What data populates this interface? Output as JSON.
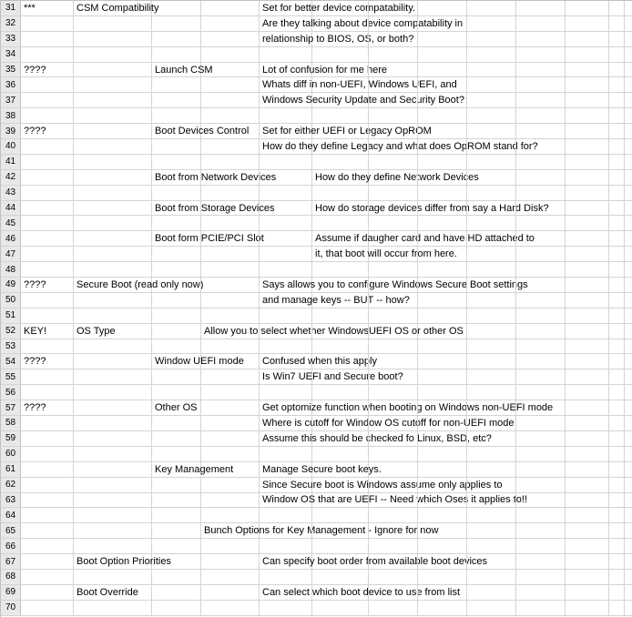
{
  "rows": [
    {
      "num": "31",
      "a": "***",
      "b": "CSM Compatibility",
      "e": "Set for better device compatability."
    },
    {
      "num": "32",
      "e": "Are they talking about device compatability in"
    },
    {
      "num": "33",
      "e": "relationship to BIOS, OS, or both?"
    },
    {
      "num": "34"
    },
    {
      "num": "35",
      "a": "????",
      "c": "Launch CSM",
      "e": "Lot of confusion for me here"
    },
    {
      "num": "36",
      "e": "Whats diff in non-UEFI, Windows UEFI, and"
    },
    {
      "num": "37",
      "e": "Windows Security Update and Security Boot?"
    },
    {
      "num": "38"
    },
    {
      "num": "39",
      "a": "????",
      "c": "Boot Devices Control",
      "e": " Set for either UEFI or Legacy OpROM"
    },
    {
      "num": "40",
      "e": "How do they define Legacy and what does OpROM stand for?"
    },
    {
      "num": "41"
    },
    {
      "num": "42",
      "c": "Boot from Network Devices",
      "f": "How do they define Network Devices"
    },
    {
      "num": "43"
    },
    {
      "num": "44",
      "c": "Boot from Storage Devices",
      "f": "How do storage devices differ from say a Hard Disk?"
    },
    {
      "num": "45"
    },
    {
      "num": "46",
      "c": "Boot form PCIE/PCI Slot",
      "f": "Assume if daugher card and have HD attached to"
    },
    {
      "num": "47",
      "f": "it, that boot will occur from here."
    },
    {
      "num": "48"
    },
    {
      "num": "49",
      "a": "????",
      "b": "Secure Boot (read only now)",
      "e": "Says allows you to configure Windows Secure Boot settings"
    },
    {
      "num": "50",
      "e": "and manage keys -- BUT -- how?"
    },
    {
      "num": "51"
    },
    {
      "num": "52",
      "a": "KEY!",
      "b": "OS Type",
      "d": "Allow you to select whether WindowsUEFI  OS or other OS"
    },
    {
      "num": "53"
    },
    {
      "num": "54",
      "a": "????",
      "c": "Window UEFI mode",
      "e": "Confused when this apply"
    },
    {
      "num": "55",
      "e": "Is Win7 UEFI and Secure boot?"
    },
    {
      "num": "56"
    },
    {
      "num": "57",
      "a": "????",
      "c": "Other OS",
      "e": "Get optomize function when booting on Windows non-UEFI mode"
    },
    {
      "num": "58",
      "e": "Where is cutoff for Window OS cutoff for non-UEFI mode"
    },
    {
      "num": "59",
      "e": "Assume this should be checked fo Linux, BSD, etc?"
    },
    {
      "num": "60"
    },
    {
      "num": "61",
      "c": "Key Management",
      "e": "Manage Secure boot keys."
    },
    {
      "num": "62",
      "e": "Since Secure boot is Windows assume only applies to"
    },
    {
      "num": "63",
      "e": "Window OS that are UEFI -- Need which Oses it applies to!!"
    },
    {
      "num": "64"
    },
    {
      "num": "65",
      "d": "Bunch Options for Key Management - Ignore for now"
    },
    {
      "num": "66"
    },
    {
      "num": "67",
      "b": "Boot Option Priorities",
      "e": "Can specify boot order from available boot devices"
    },
    {
      "num": "68"
    },
    {
      "num": "69",
      "b": "Boot Override",
      "e": "Can select which boot device to use from list"
    },
    {
      "num": "70"
    }
  ]
}
